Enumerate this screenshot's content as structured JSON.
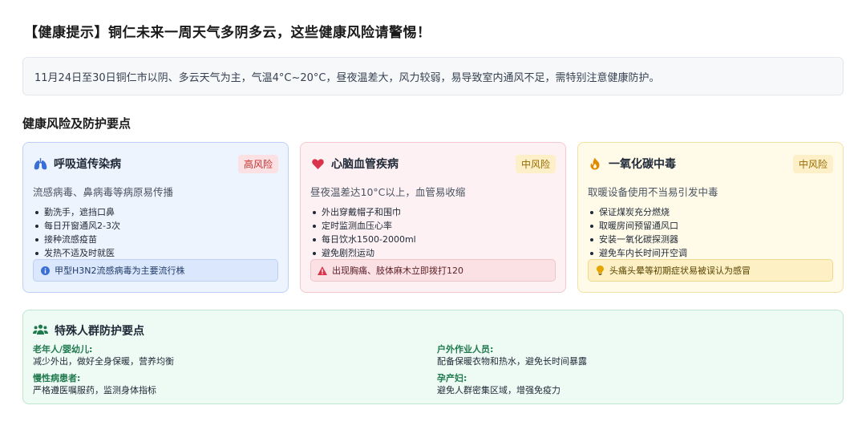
{
  "page": {
    "title": "【健康提示】铜仁未来一周天气多阴多云，这些健康风险请警惕！",
    "summary": "11月24日至30日铜仁市以阴、多云天气为主，气温4°C~20°C，昼夜温差大，风力较弱，易导致室内通风不足，需特别注意健康防护。",
    "section_title": "健康风险及防护要点"
  },
  "cards": [
    {
      "icon": "lungs-icon",
      "title": "呼吸道传染病",
      "risk": "高风险",
      "desc": "流感病毒、鼻病毒等病原易传播",
      "items": [
        "勤洗手，遮挡口鼻",
        "每日开窗通风2-3次",
        "接种流感疫苗",
        "发热不适及时就医"
      ],
      "note_icon": "info-icon",
      "note": "甲型H3N2流感病毒为主要流行株"
    },
    {
      "icon": "heart-icon",
      "title": "心脑血管疾病",
      "risk": "中风险",
      "desc": "昼夜温差达10°C以上，血管易收缩",
      "items": [
        "外出穿戴帽子和围巾",
        "定时监测血压心率",
        "每日饮水1500-2000ml",
        "避免剧烈运动"
      ],
      "note_icon": "warning-icon",
      "note": "出现胸痛、肢体麻木立即拨打120"
    },
    {
      "icon": "fire-icon",
      "title": "一氧化碳中毒",
      "risk": "中风险",
      "desc": "取暖设备使用不当易引发中毒",
      "items": [
        "保证煤炭充分燃烧",
        "取暖房间预留通风口",
        "安装一氧化碳探测器",
        "避免车内长时间开空调"
      ],
      "note_icon": "lightbulb-icon",
      "note": "头痛头晕等初期症状易被误认为感冒"
    }
  ],
  "special": {
    "icon": "people-group-icon",
    "title": "特殊人群防护要点",
    "groups": [
      {
        "label": "老年人/婴幼儿:",
        "text": "减少外出，做好全身保暖，营养均衡"
      },
      {
        "label": "户外作业人员:",
        "text": "配备保暖衣物和热水，避免长时间暴露"
      },
      {
        "label": "慢性病患者:",
        "text": "严格遵医嘱服药，监测身体指标"
      },
      {
        "label": "孕产妇:",
        "text": "避免人群密集区域，增强免疫力"
      }
    ]
  },
  "colors": {
    "blue_accent": "#3b6fd8",
    "red_accent": "#d9344a",
    "yellow_accent": "#e08a00",
    "green_accent": "#1f7a4d"
  }
}
